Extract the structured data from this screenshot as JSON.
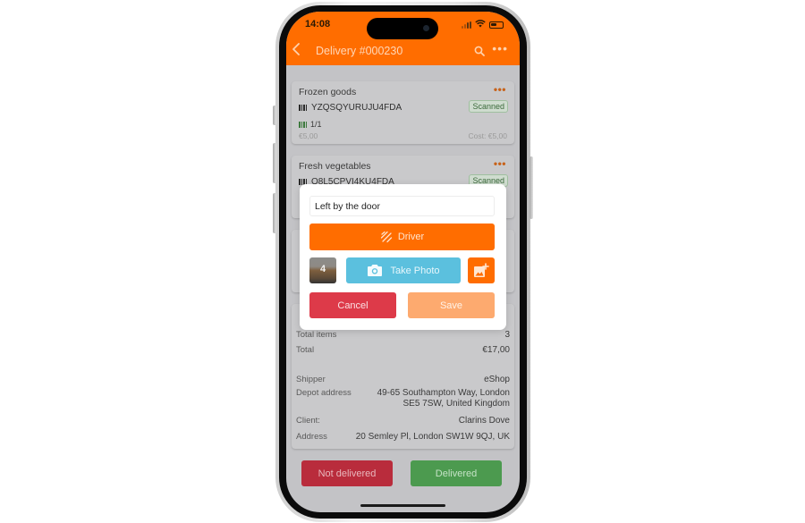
{
  "status_bar": {
    "time": "14:08"
  },
  "header": {
    "title": "Delivery #000230"
  },
  "items": [
    {
      "name": "Frozen goods",
      "code": "YZQSQYURUJU4FDA",
      "status": "Scanned",
      "quantity": "1/1",
      "price": "€5,00",
      "cost": "Cost: €5,00"
    },
    {
      "name": "Fresh vegetables",
      "code": "O8L5CPVI4KU4FDA",
      "status": "Scanned"
    }
  ],
  "summary": {
    "rows": [
      {
        "label": "Total items",
        "value": "3"
      },
      {
        "label": "Total",
        "value": "€17,00"
      },
      {
        "label": "Shipper",
        "value": "eShop"
      },
      {
        "label": "Depot address",
        "value_line1": "49-65 Southampton Way, London",
        "value_line2": "SE5 7SW, United Kingdom"
      },
      {
        "label": "Client:",
        "value": "Clarins Dove"
      },
      {
        "label": "Address",
        "value": "20 Semley Pl, London SW1W 9QJ, UK"
      }
    ]
  },
  "actions": {
    "not_delivered": "Not delivered",
    "delivered": "Delivered"
  },
  "modal": {
    "note_value": "Left by the door",
    "driver_label": "Driver",
    "photo_count": "4",
    "take_photo_label": "Take Photo",
    "cancel_label": "Cancel",
    "save_label": "Save"
  },
  "colors": {
    "brand": "#ff6d00",
    "danger": "#dd3a49",
    "success": "#4c9a4f",
    "info": "#5bc0de"
  }
}
